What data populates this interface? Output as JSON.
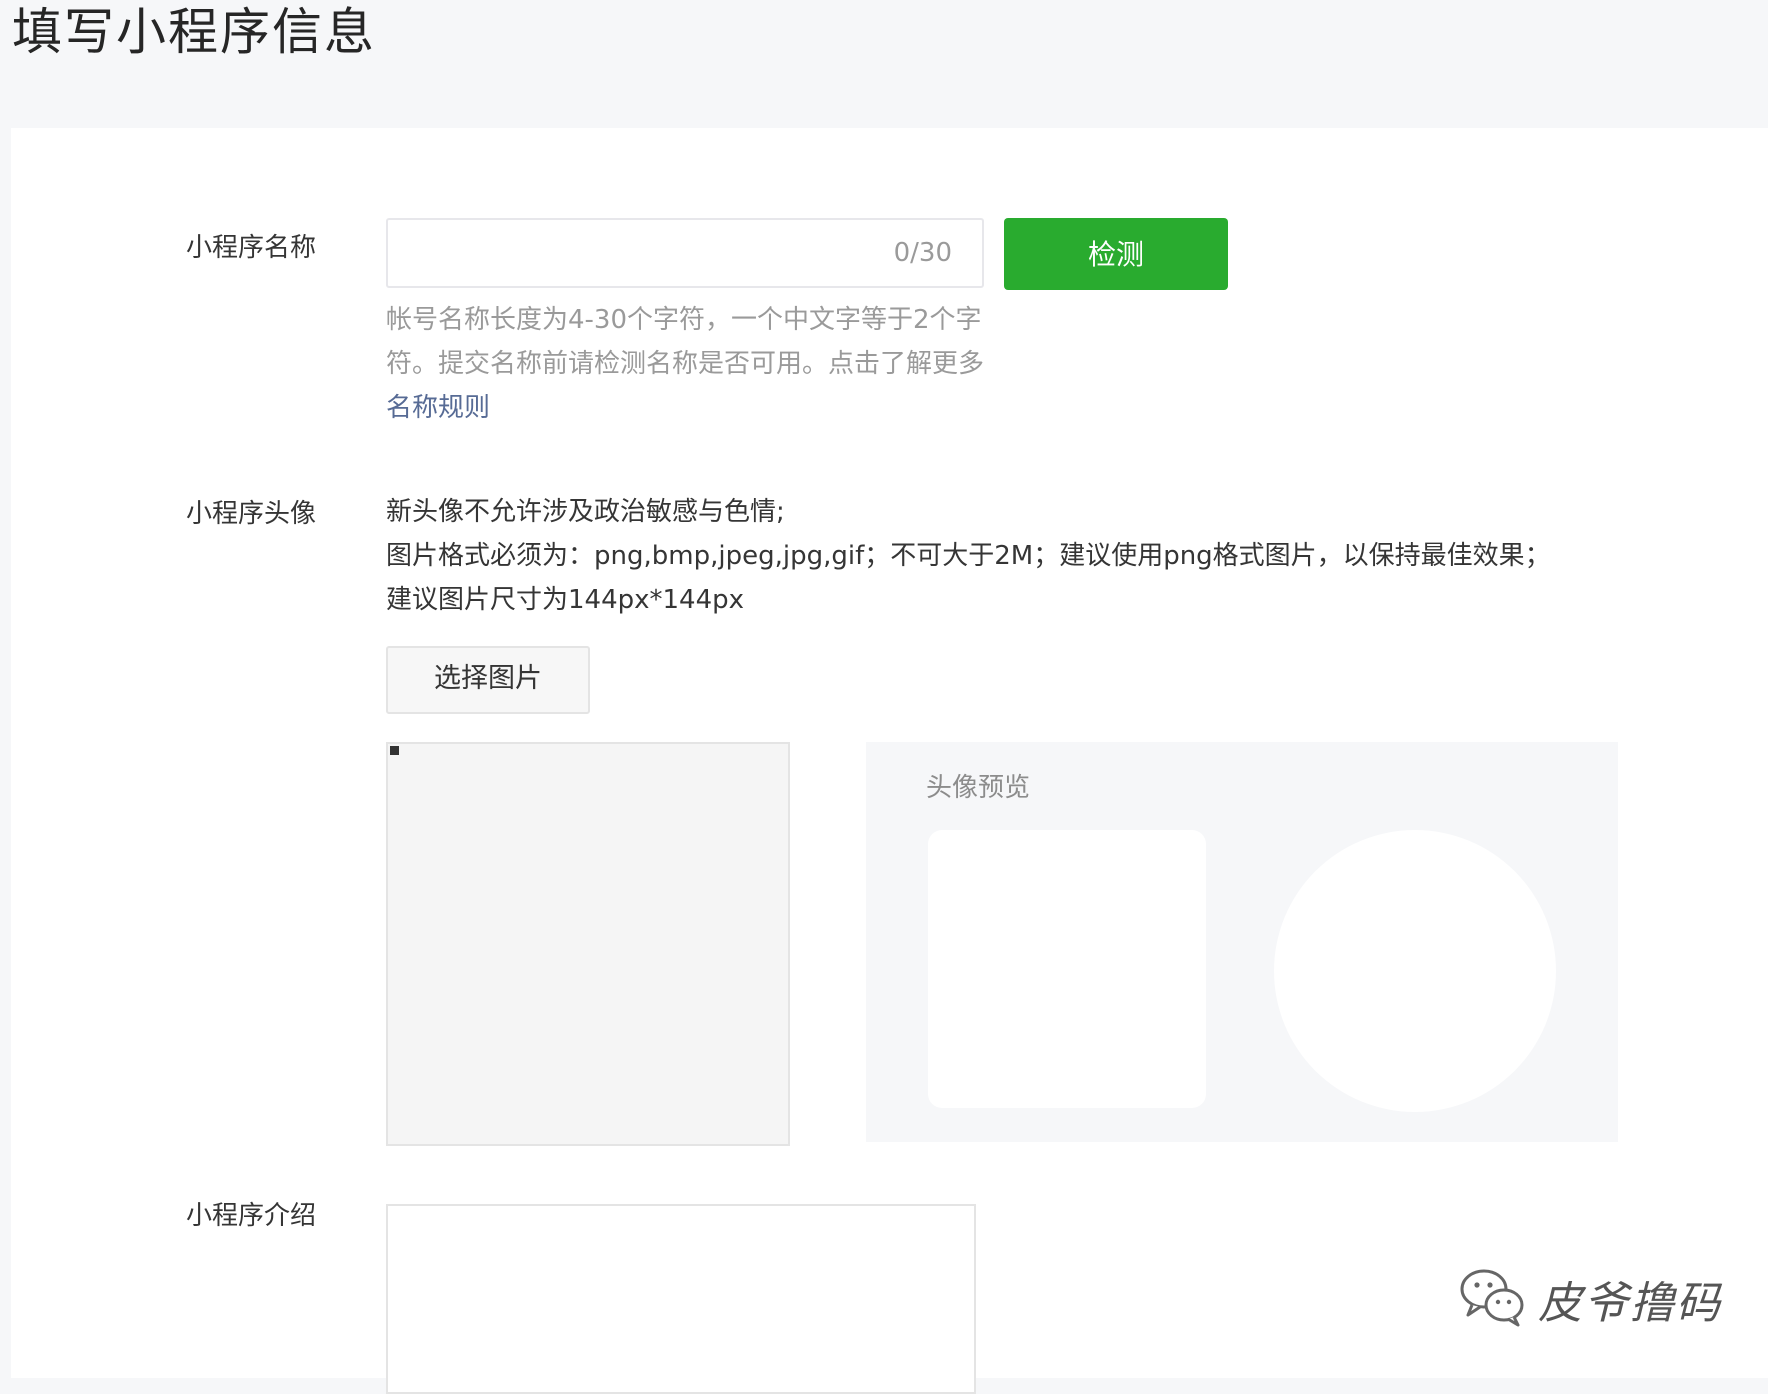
{
  "page": {
    "title": "填写小程序信息"
  },
  "name_section": {
    "label": "小程序名称",
    "input_value": "",
    "counter": "0/30",
    "check_button": "检测",
    "hint_text": "帐号名称长度为4-30个字符，一个中文字等于2个字符。提交名称前请检测名称是否可用。点击了解更多",
    "hint_link": "名称规则"
  },
  "avatar_section": {
    "label": "小程序头像",
    "requirements": [
      "新头像不允许涉及政治敏感与色情;",
      "图片格式必须为：png,bmp,jpeg,jpg,gif；不可大于2M；建议使用png格式图片，以保持最佳效果；",
      "建议图片尺寸为144px*144px"
    ],
    "select_button": "选择图片",
    "preview_title": "头像预览"
  },
  "intro_section": {
    "label": "小程序介绍",
    "value": ""
  },
  "watermark": {
    "text": "皮爷撸码",
    "icon": "wechat-logo-icon"
  },
  "colors": {
    "primary_green": "#29ab2f",
    "link_blue": "#576b95",
    "hint_gray": "#9a9a9a",
    "page_background": "#f6f7f9"
  }
}
